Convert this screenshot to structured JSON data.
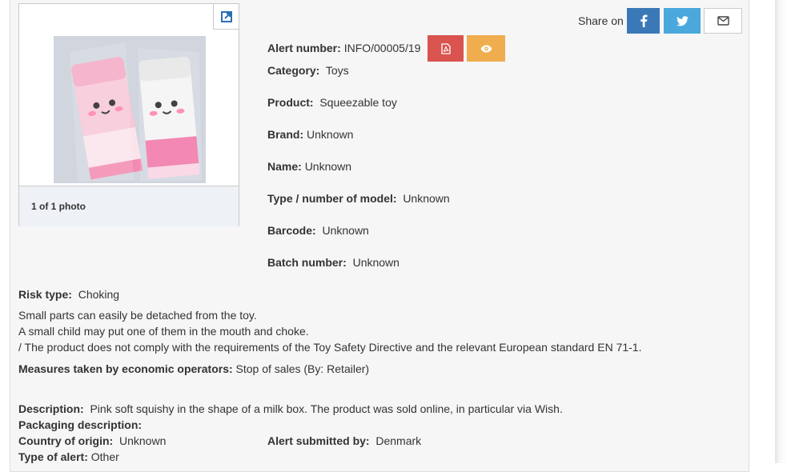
{
  "photo": {
    "caption": "1 of 1 photo",
    "expand_icon": "external-link-icon"
  },
  "share": {
    "label": "Share on",
    "icons": [
      "facebook-icon",
      "twitter-icon",
      "envelope-icon"
    ],
    "colors": {
      "facebook": "#3b78b8",
      "twitter": "#4aa8dc",
      "email": "#ffffff"
    }
  },
  "alert": {
    "number_label": "Alert number:",
    "number": "INFO/00005/19",
    "pdf_icon": "pdf-icon",
    "view_icon": "eye-icon",
    "colors": {
      "pdf": "#d9534f",
      "view": "#f0ad4e"
    }
  },
  "details": [
    {
      "label": "Category:",
      "value": "Toys"
    },
    {
      "label": "Product:",
      "value": "Squeezable toy"
    },
    {
      "label": "Brand:",
      "value": "Unknown"
    },
    {
      "label": "Name:",
      "value": "Unknown"
    },
    {
      "label": "Type / number of model:",
      "value": "Unknown"
    },
    {
      "label": "Barcode:",
      "value": "Unknown"
    },
    {
      "label": "Batch number:",
      "value": "Unknown"
    }
  ],
  "risk": {
    "type_label": "Risk type:",
    "type": "Choking",
    "lines": [
      "Small parts can easily be detached from the toy.",
      "A small child may put one of them in the mouth and choke.",
      "/ The product does not comply with the requirements of the Toy Safety Directive and the relevant European standard EN 71-1."
    ]
  },
  "measures": {
    "label": "Measures taken by economic operators:",
    "value": "Stop of sales (By: Retailer)"
  },
  "description": {
    "label": "Description:",
    "value": "Pink soft squishy in the shape of a milk box. The product was sold online, in particular via Wish."
  },
  "packaging": {
    "label": "Packaging description:",
    "value": ""
  },
  "origin": {
    "label": "Country of origin:",
    "value": "Unknown"
  },
  "submitted": {
    "label": "Alert submitted by:",
    "value": "Denmark"
  },
  "alert_type": {
    "label": "Type of alert:",
    "value": "Other"
  }
}
